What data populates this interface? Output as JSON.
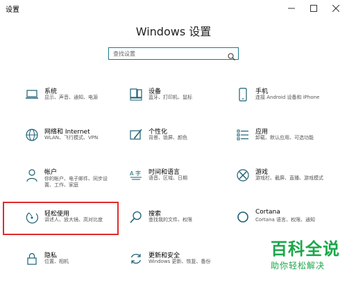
{
  "window": {
    "title": "设置",
    "minimize_symbol": "—",
    "maximize_symbol": "☐",
    "close_symbol": "✕"
  },
  "header": {
    "title": "Windows 设置"
  },
  "search": {
    "placeholder": "查找设置"
  },
  "tiles": [
    {
      "id": "system",
      "name": "系统",
      "desc": "显示、声音、通知、电源",
      "icon": "laptop-icon"
    },
    {
      "id": "devices",
      "name": "设备",
      "desc": "蓝牙、打印机、鼠标",
      "icon": "keyboard-devices-icon"
    },
    {
      "id": "phone",
      "name": "手机",
      "desc": "连接 Android 设备和 iPhone",
      "icon": "phone-icon"
    },
    {
      "id": "network",
      "name": "网络和 Internet",
      "desc": "WLAN、飞行模式、VPN",
      "icon": "globe-icon"
    },
    {
      "id": "personal",
      "name": "个性化",
      "desc": "背景、锁屏、颜色",
      "icon": "brush-icon"
    },
    {
      "id": "apps",
      "name": "应用",
      "desc": "卸载、默认应用、可选功能",
      "icon": "apps-list-icon"
    },
    {
      "id": "accounts",
      "name": "帐户",
      "desc": "你的帐户、电子邮件、同步设置、工作、家庭",
      "icon": "person-icon"
    },
    {
      "id": "time",
      "name": "时间和语言",
      "desc": "语音、区域、日期",
      "icon": "time-language-icon"
    },
    {
      "id": "gaming",
      "name": "游戏",
      "desc": "游戏栏、截屏、直播、游戏模式",
      "icon": "xbox-icon"
    },
    {
      "id": "ease",
      "name": "轻松使用",
      "desc": "讲述人、放大镜、高对比度",
      "icon": "ease-of-access-icon"
    },
    {
      "id": "search",
      "name": "搜索",
      "desc": "查找我的文件、权限",
      "icon": "magnifier-icon"
    },
    {
      "id": "cortana",
      "name": "Cortana",
      "desc": "Cortana 语言、权限、通知",
      "icon": "cortana-ring-icon"
    },
    {
      "id": "privacy",
      "name": "隐私",
      "desc": "位置、相机",
      "icon": "lock-icon"
    },
    {
      "id": "update",
      "name": "更新和安全",
      "desc": "Windows 更新、恢复、备份",
      "icon": "sync-icon"
    }
  ],
  "watermark": {
    "main": "百科全说",
    "sub": "助你轻松解决"
  },
  "colors": {
    "accent": "#1a7a8c",
    "icon": "#1a5f73",
    "highlight": "#e02b2b",
    "watermark": "#1aa84a"
  }
}
